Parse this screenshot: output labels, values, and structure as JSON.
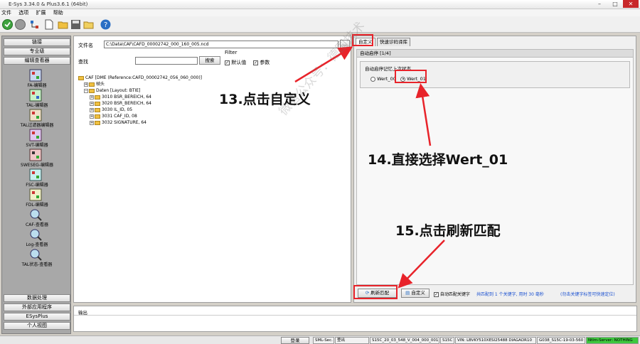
{
  "window": {
    "title": "E-Sys 3.34.0 & Plus3.6.1  (64bit)",
    "min": "–",
    "max": "□",
    "close": "✕"
  },
  "menu": [
    "文件",
    "选项",
    "扩展",
    "帮助"
  ],
  "sidebar": {
    "top_tabs": [
      "链接",
      "专业级",
      "编辑查看器"
    ],
    "items": [
      "FA-编辑器",
      "TAL-编辑器",
      "TAL过滤器编辑器",
      "SVT-编辑器",
      "SWESEG-编辑器",
      "FSC-编辑器",
      "FDL-编辑器",
      "CAF-查看器",
      "Log-查看器",
      "TAL状态-查看器"
    ],
    "bottom_tabs": [
      "数据处理",
      "外部应用程序",
      "ESysPlus",
      "个人视图"
    ]
  },
  "left_panel": {
    "file_label": "文件名",
    "file_value": "C:\\Data\\CAF\\CAFD_00002742_000_160_005.ncd",
    "browse_label": "...",
    "find_label": "查找",
    "search_button": "搜索",
    "filter_label": "Filter",
    "filter_default": "默认值",
    "filter_param": "参数",
    "check_mark": "✓",
    "tree": [
      {
        "exp": "−",
        "text": "CAF [DME (Reference:CAFD_00002742_056_060_000)]"
      },
      {
        "exp": "+",
        "text": "帧头"
      },
      {
        "exp": "−",
        "text": "Daten [Layout: BTIE]"
      },
      {
        "exp": "+",
        "text": "3010 BSR_BEREICH, 64"
      },
      {
        "exp": "+",
        "text": "3020 BSR_BEREICH, 64"
      },
      {
        "exp": "+",
        "text": "3030 IL_ID, 05"
      },
      {
        "exp": "+",
        "text": "3031 CAF_ID, 08"
      },
      {
        "exp": "+",
        "text": "3032 SIGNATURE, 64"
      }
    ]
  },
  "right_panel": {
    "tabs": [
      "自定义",
      "快速诊码译库"
    ],
    "header": "自动启停 [1/4]",
    "group_label": "自动启停记忆上次状态",
    "options": [
      "Wert_00",
      "Wert_01"
    ],
    "selected": "Wert_01"
  },
  "bottom_toolbar": {
    "refresh": "刷新匹配",
    "custom": "自定义",
    "auto_match": "自动匹配关键字",
    "info_blue": "共匹配到 1 个关键字, 用时 30 毫秒",
    "tip_blue": "(勿击关键字标签可快速定位)"
  },
  "log_label": "输出",
  "statusbar": {
    "login": "登录",
    "sml": "SML-Sec.",
    "logout": "登出",
    "c1": "S15C_20_03_548_V_004_000_001",
    "c2": "S15C",
    "c3": "VIN: LBVKY510XESI25488 DIAGADR10",
    "c4": "G038_S15C-19-03-560",
    "c5": "Ntlm-Server: NOTHING"
  },
  "annotations": {
    "a13": "13.点击自定义",
    "a14": "14.直接选择Wert_01",
    "a15": "15.点击刷新匹配"
  },
  "watermark": "微信公众号：德国技术"
}
